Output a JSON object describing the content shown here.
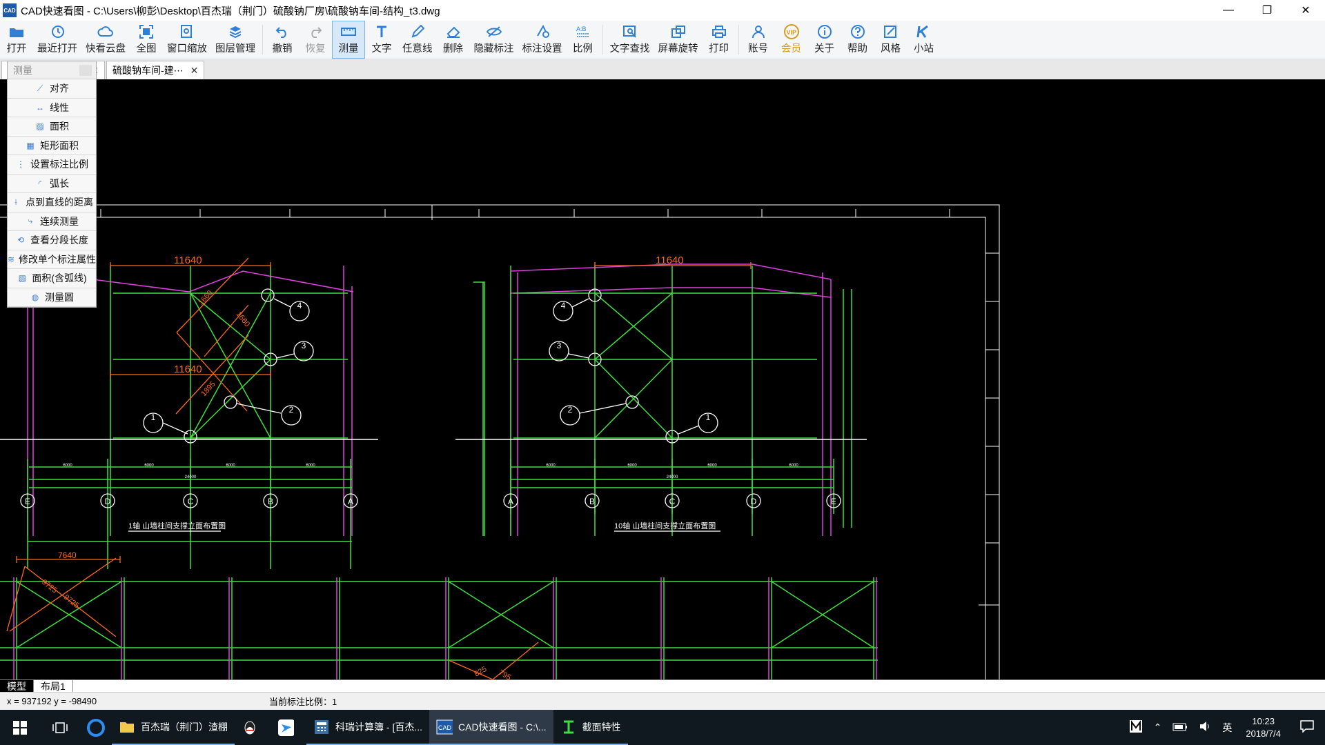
{
  "window": {
    "title": "CAD快速看图 - C:\\Users\\柳彭\\Desktop\\百杰瑞（荆门）硫酸钠厂房\\硫酸钠车间-结构_t3.dwg",
    "app_icon_text": "CAD"
  },
  "toolbar": {
    "open": "打开",
    "recent": "最近打开",
    "cloud": "快看云盘",
    "fullview": "全图",
    "window_zoom": "窗口缩放",
    "layers": "图层管理",
    "undo": "撤销",
    "redo": "恢复",
    "measure": "测量",
    "text": "文字",
    "freeline": "任意线",
    "delete": "删除",
    "hide_dim": "隐藏标注",
    "dim_settings": "标注设置",
    "scale": "比例",
    "text_search": "文字查找",
    "rotate": "屏幕旋转",
    "print": "打印",
    "account": "账号",
    "vip": "会员",
    "about": "关于",
    "help": "帮助",
    "style": "风格",
    "station": "小站"
  },
  "tabs": {
    "tab2": "硫酸钠车间-建⋯"
  },
  "measure_menu": {
    "header": "测量",
    "items": [
      "对齐",
      "线性",
      "面积",
      "矩形面积",
      "设置标注比例",
      "弧长",
      "点到直线的距离",
      "连续测量",
      "查看分段长度",
      "修改单个标注属性",
      "面积(含弧线)",
      "测量圆"
    ]
  },
  "drawing": {
    "dim_left_top": "11640",
    "dim_left_mid": "11640",
    "dim_right_top": "11640",
    "dim_bottom_left": "7640",
    "caption_left": "1轴 山墙柱间支撑立面布置图",
    "caption_right": "10轴 山墙柱间支撑立面布置图",
    "grid_left": [
      "E",
      "D",
      "C",
      "B",
      "A"
    ],
    "grid_right": [
      "A",
      "B",
      "C",
      "D",
      "E"
    ],
    "spans_left": [
      "6000",
      "6000",
      "6000",
      "6000"
    ],
    "spans_right": [
      "6000",
      "6000",
      "6000",
      "6000"
    ],
    "total_left": "24000",
    "total_right": "24000",
    "callouts_left": [
      "4",
      "3",
      "1",
      "2"
    ],
    "callouts_right": [
      "4",
      "3",
      "2",
      "1"
    ],
    "oblique_dims": [
      "1660",
      "1660",
      "1895",
      "9725",
      "9725",
      "825",
      "795"
    ]
  },
  "layout_tabs": {
    "model": "模型",
    "layout1": "布局1"
  },
  "status": {
    "coords": "x = 937192  y = -98490",
    "scale": "当前标注比例：1"
  },
  "taskbar": {
    "app1": "百杰瑞（荆门）渣棚",
    "app2": "科瑞计算簿 - [百杰...",
    "app3": "CAD快速看图 - C:\\...",
    "app4": "截面特性",
    "ime": "英",
    "time": "10:23",
    "date": "2018/7/4"
  }
}
